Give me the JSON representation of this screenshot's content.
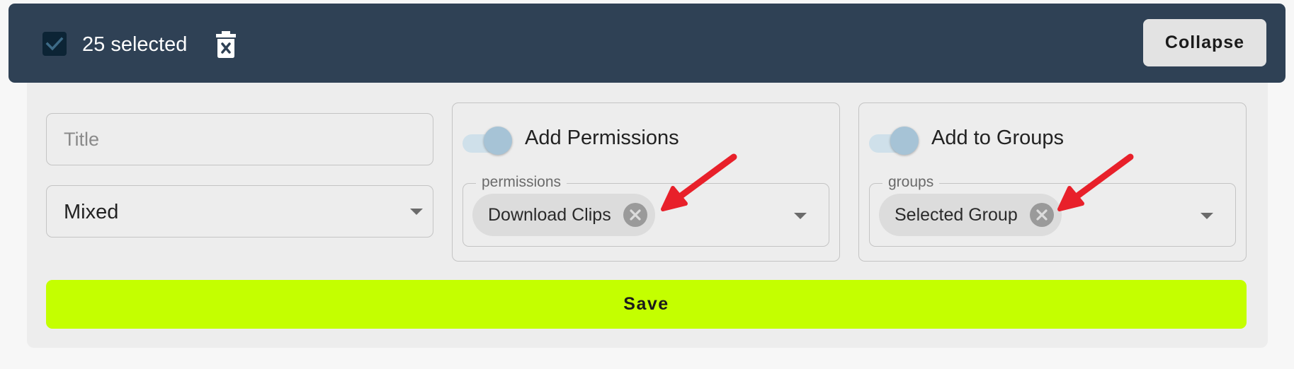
{
  "toolbar": {
    "selected_count": "25 selected",
    "collapse_label": "Collapse"
  },
  "form": {
    "title_placeholder": "Title",
    "title_value": "",
    "status_value": "Mixed",
    "permissions": {
      "toggle_label": "Add Permissions",
      "toggle_on": true,
      "field_label": "permissions",
      "chips": [
        "Download Clips"
      ]
    },
    "groups": {
      "toggle_label": "Add to Groups",
      "toggle_on": true,
      "field_label": "groups",
      "chips": [
        "Selected Group"
      ]
    },
    "save_label": "Save"
  },
  "colors": {
    "topbar": "#2f4155",
    "save": "#c4ff00",
    "annotation_arrow": "#e8202a",
    "toggle_thumb": "#a6c3d6"
  }
}
